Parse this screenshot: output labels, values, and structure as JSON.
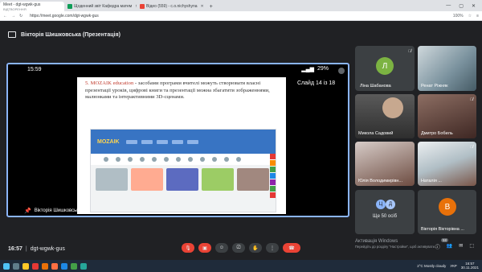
{
  "browser": {
    "tabs": [
      {
        "title": "Meet - dgt-wgwk-gus",
        "subtitle": "ВІДТВОРЕННЯ"
      },
      {
        "title": "Щоденний звіт Кафедра матем"
      },
      {
        "title": "Відео (559) - c.o.nichyshyna"
      }
    ],
    "url": "https://meet.google.com/dgt-wgwk-gus",
    "zoom": "100%"
  },
  "meet": {
    "presenter_title": "Вікторія Шишковська (Презентація)",
    "meeting_time": "16:57",
    "meeting_code": "dgt-wgwk-gus",
    "participant_count": "58"
  },
  "stage": {
    "phone_time": "15:59",
    "battery": "29%",
    "slide_counter": "Слайд 14 із 18",
    "presenter_name": "Вікторія Шишковська",
    "slide": {
      "heading": "5. MOZAIK education",
      "body": " - засобами програми вчителі можуть створювати власні презентації уроків, цифрові книги та презентації можна збагатити зображеннями, малюнками та інтерактивними 3D-сценами.",
      "mozaik_logo": "MOZAIK"
    }
  },
  "participants": [
    {
      "name": "Ліна Шабанова",
      "initial": "Л",
      "color": "#7cb342"
    },
    {
      "name": "Ренат Ріжняк"
    },
    {
      "name": "Микола Садовий"
    },
    {
      "name": "Дмитро Бобиль"
    },
    {
      "name": "Юлія Володимирівн..."
    },
    {
      "name": "Наталія ..."
    }
  ],
  "more_tile": {
    "label": "Ще 50 осіб",
    "initials": [
      "Ц",
      "Д"
    ]
  },
  "self_tile": {
    "name": "Вікторія Вікторівна ...",
    "initial": "В",
    "color": "#e8710a"
  },
  "activation": {
    "title": "Активація Windows",
    "hint": "Перейдіть до розділу \"Настройки\", щоб активувати..."
  },
  "taskbar": {
    "weather": "2°C  Mostly cloudy",
    "language": "УКР",
    "time": "16:57",
    "date": "30.11.2021"
  }
}
